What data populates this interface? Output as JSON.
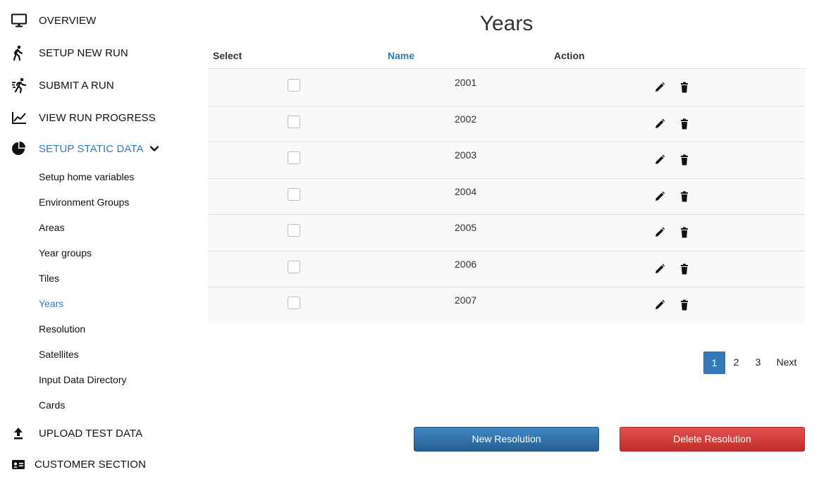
{
  "sidebar": {
    "top_items": [
      {
        "label": "OVERVIEW",
        "icon": "monitor-icon"
      },
      {
        "label": "SETUP NEW RUN",
        "icon": "walking-icon"
      },
      {
        "label": "SUBMIT A RUN",
        "icon": "running-icon"
      },
      {
        "label": "VIEW RUN PROGRESS",
        "icon": "line-chart-icon"
      },
      {
        "label": "SETUP STATIC DATA",
        "icon": "pie-chart-icon"
      }
    ],
    "sub_items": [
      {
        "label": "Setup home variables"
      },
      {
        "label": "Environment Groups"
      },
      {
        "label": "Areas"
      },
      {
        "label": "Year groups"
      },
      {
        "label": "Tiles"
      },
      {
        "label": "Years"
      },
      {
        "label": "Resolution"
      },
      {
        "label": "Satellites"
      },
      {
        "label": "Input Data Directory"
      },
      {
        "label": "Cards"
      }
    ],
    "bottom_items": [
      {
        "label": "UPLOAD TEST DATA",
        "icon": "upload-icon"
      },
      {
        "label": "CUSTOMER SECTION",
        "icon": "id-card-icon"
      }
    ]
  },
  "page": {
    "title": "Years"
  },
  "table": {
    "headers": {
      "select": "Select",
      "name": "Name",
      "action": "Action"
    },
    "rows": [
      {
        "name": "2001"
      },
      {
        "name": "2002"
      },
      {
        "name": "2003"
      },
      {
        "name": "2004"
      },
      {
        "name": "2005"
      },
      {
        "name": "2006"
      },
      {
        "name": "2007"
      }
    ]
  },
  "pagination": {
    "pages": [
      "1",
      "2",
      "3"
    ],
    "next": "Next",
    "current": "1"
  },
  "actions": {
    "new_label": "New Resolution",
    "delete_label": "Delete Resolution"
  },
  "colors": {
    "accent": "#337ab7",
    "danger": "#d9534f",
    "row_bg": "#f9f9f9"
  }
}
